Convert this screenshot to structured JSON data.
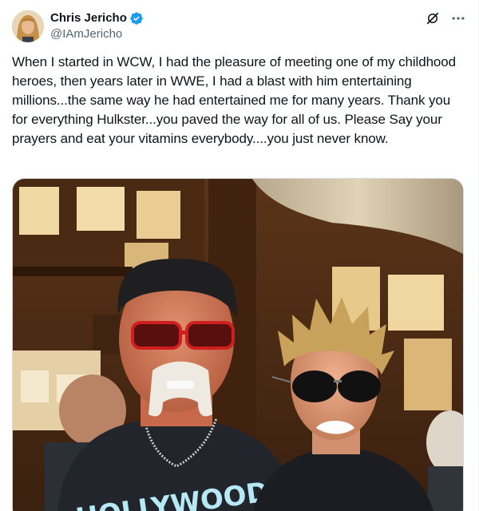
{
  "author": {
    "display_name": "Chris Jericho",
    "handle": "@IAmJericho",
    "verified": true,
    "avatar_icon": "avatar"
  },
  "actions": {
    "grok_icon": "grok-icon",
    "more_icon": "more-horizontal-icon"
  },
  "tweet": {
    "text": "When I started in WCW, I had the pleasure of meeting one of my childhood heroes, then years later in WWE, I had a blast with him entertaining millions...the same way he had entertained me for many years. Thank you for everything Hulkster...you paved the way for all of us. Please Say your prayers and eat your vitamins everybody....you just never know."
  },
  "media": {
    "shirt_text": "HOLLYWOOD"
  },
  "colors": {
    "verified": "#1d9bf0",
    "text": "#0f1419",
    "secondary": "#536471"
  }
}
